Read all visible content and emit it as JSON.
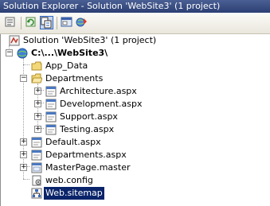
{
  "window": {
    "title": "Solution Explorer - Solution 'WebSite3' (1 project)"
  },
  "toolbar": {
    "buttons": [
      {
        "icon": "properties-icon"
      },
      {
        "icon": "refresh-icon"
      },
      {
        "icon": "nest-related-files-icon",
        "selected": true
      },
      {
        "icon": "view-designer-icon"
      },
      {
        "icon": "copy-web-site-icon"
      }
    ]
  },
  "tree": {
    "solution": "Solution 'WebSite3' (1 project)",
    "project": "C:\\...\\WebSite3\\",
    "app_data": "App_Data",
    "departments": "Departments",
    "department_pages": [
      "Architecture.aspx",
      "Development.aspx",
      "Support.aspx",
      "Testing.aspx"
    ],
    "default_page": "Default.aspx",
    "departments_page": "Departments.aspx",
    "master_page": "MasterPage.master",
    "web_config": "web.config",
    "web_sitemap": "Web.sitemap"
  },
  "colors": {
    "selection": "#0a246a",
    "titlebar": "#2b3f74"
  }
}
